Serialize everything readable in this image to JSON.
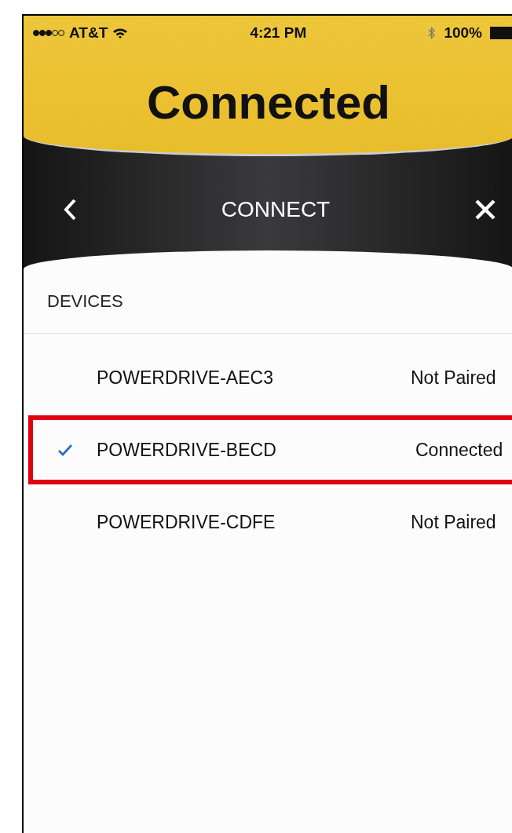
{
  "status_bar": {
    "carrier": "AT&T",
    "time": "4:21 PM",
    "battery": "100%"
  },
  "header": {
    "title": "Connected"
  },
  "nav": {
    "title": "CONNECT"
  },
  "devices": {
    "heading": "DEVICES",
    "items": [
      {
        "name": "POWERDRIVE-AEC3",
        "status": "Not Paired",
        "selected": false
      },
      {
        "name": "POWERDRIVE-BECD",
        "status": "Connected",
        "selected": true
      },
      {
        "name": "POWERDRIVE-CDFE",
        "status": "Not Paired",
        "selected": false
      }
    ]
  }
}
